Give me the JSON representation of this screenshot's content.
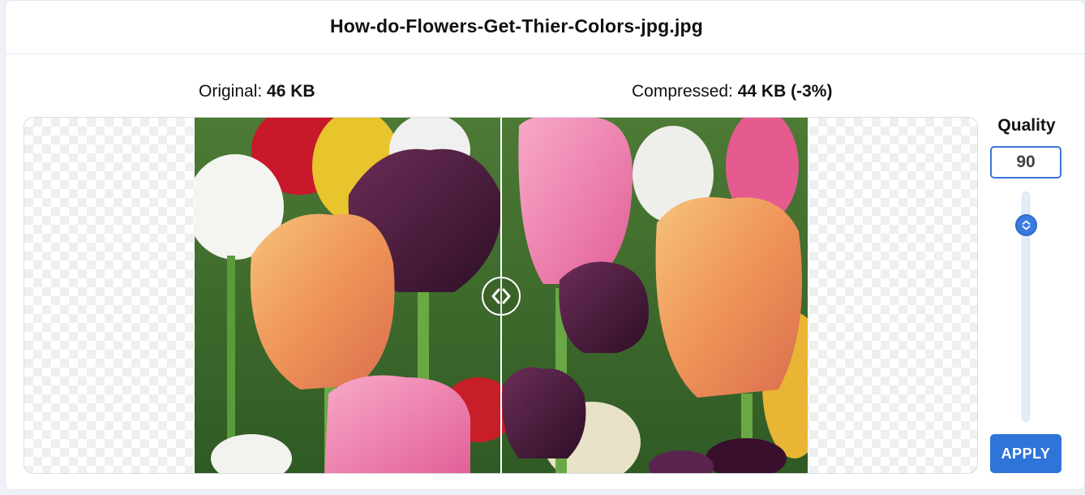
{
  "file": {
    "name": "How-do-Flowers-Get-Thier-Colors-jpg.jpg"
  },
  "original": {
    "label": "Original:",
    "size": "46 KB"
  },
  "compressed": {
    "label": "Compressed:",
    "size": "44 KB",
    "change": "(-3%)"
  },
  "comparison": {
    "image": "tulips-photo",
    "divider_position": 0.5
  },
  "quality": {
    "label": "Quality",
    "value": "90",
    "slider_value": 90
  },
  "actions": {
    "apply_label": "APPLY"
  },
  "icons": {
    "compare_handle": "chevrons-left-right-icon",
    "slider_thumb": "chevron-up-down-icon"
  },
  "colors": {
    "accent": "#2f74d8",
    "text": "#111111"
  }
}
